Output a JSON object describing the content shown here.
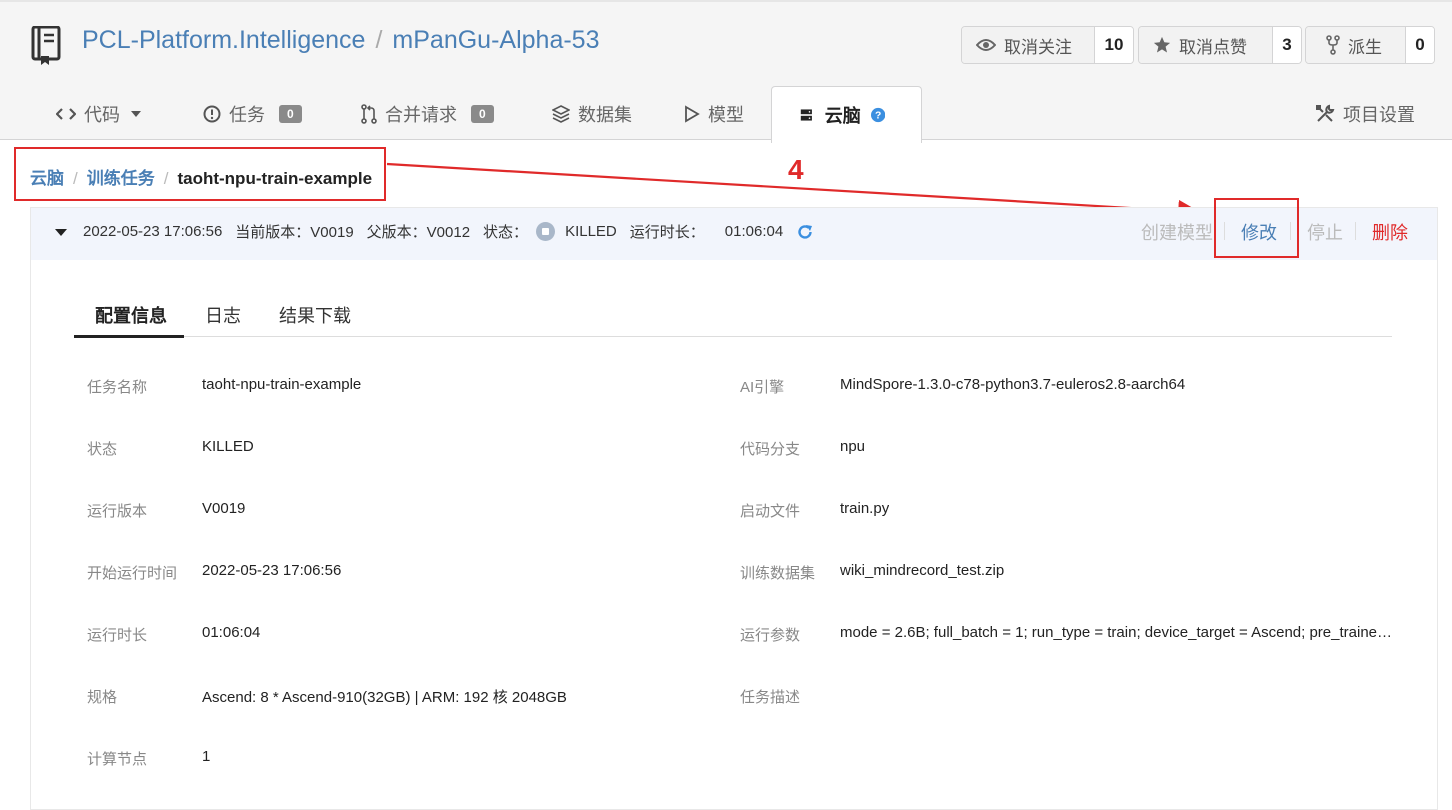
{
  "repo": {
    "owner": "PCL-Platform.Intelligence",
    "separator": "/",
    "name": "mPanGu-Alpha-53"
  },
  "header_buttons": {
    "watch": {
      "label": "取消关注",
      "count": "10",
      "icon": "eye-icon"
    },
    "star": {
      "label": "取消点赞",
      "count": "3",
      "icon": "star-icon"
    },
    "fork": {
      "label": "派生",
      "count": "0",
      "icon": "fork-icon"
    }
  },
  "tabs": {
    "code": {
      "label": "代码"
    },
    "issues": {
      "label": "任务",
      "badge": "0"
    },
    "pulls": {
      "label": "合并请求",
      "badge": "0"
    },
    "datasets": {
      "label": "数据集"
    },
    "models": {
      "label": "模型"
    },
    "cloudbrain": {
      "label": "云脑"
    },
    "settings": {
      "label": "项目设置"
    }
  },
  "breadcrumb": {
    "root": "云脑",
    "section": "训练任务",
    "current": "taoht-npu-train-example",
    "sep": "/"
  },
  "annotation_number": "4",
  "version_bar": {
    "created": "2022-05-23 17:06:56",
    "current_version_label": "当前版本：V0019",
    "parent_version_label": "父版本：V0012",
    "status_label": "状态：",
    "status_value": "KILLED",
    "duration_label": "运行时长：",
    "duration_value": "01:06:04"
  },
  "actions": {
    "create_model": "创建模型",
    "edit": "修改",
    "stop": "停止",
    "delete": "删除"
  },
  "inner_tabs": {
    "config": "配置信息",
    "log": "日志",
    "download": "结果下载"
  },
  "info_left": {
    "task_name": {
      "key": "任务名称",
      "value": "taoht-npu-train-example"
    },
    "status": {
      "key": "状态",
      "value": "KILLED"
    },
    "version": {
      "key": "运行版本",
      "value": "V0019"
    },
    "start_time": {
      "key": "开始运行时间",
      "value": "2022-05-23 17:06:56"
    },
    "duration": {
      "key": "运行时长",
      "value": "01:06:04"
    },
    "spec": {
      "key": "规格",
      "value": "Ascend: 8 * Ascend-910(32GB) | ARM: 192 核 2048GB"
    },
    "nodes": {
      "key": "计算节点",
      "value": "1"
    }
  },
  "info_right": {
    "engine": {
      "key": "AI引擎",
      "value": "MindSpore-1.3.0-c78-python3.7-euleros2.8-aarch64"
    },
    "branch": {
      "key": "代码分支",
      "value": "npu"
    },
    "boot_file": {
      "key": "启动文件",
      "value": "train.py"
    },
    "dataset": {
      "key": "训练数据集",
      "value": "wiki_mindrecord_test.zip"
    },
    "params": {
      "key": "运行参数",
      "value": "mode = 2.6B; full_batch = 1; run_type = train; device_target = Ascend; pre_trained = ..."
    },
    "desc": {
      "key": "任务描述",
      "value": ""
    }
  }
}
